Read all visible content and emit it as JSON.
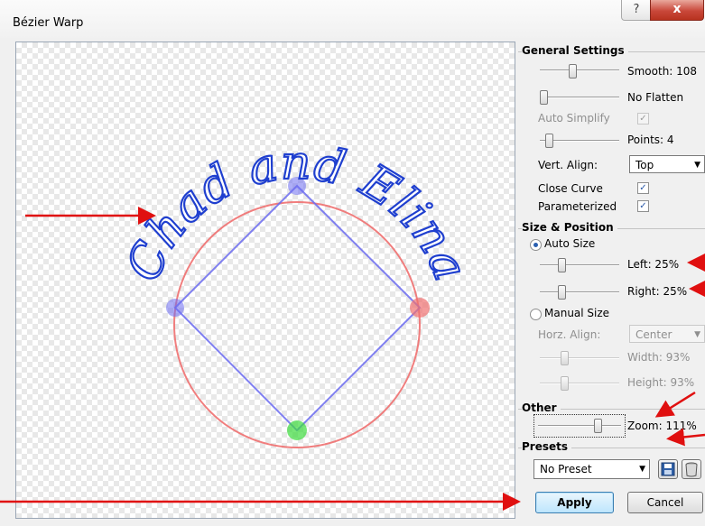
{
  "window": {
    "title": "Bézier Warp",
    "help_label": "?",
    "close_label": "x"
  },
  "canvas": {
    "text": "Chad and Elina",
    "colors": {
      "circle": "#f07070",
      "square": "#6b6bf0",
      "text_outline": "#1f3fcf",
      "green_handle": "#3ddc3d"
    }
  },
  "general": {
    "heading": "General Settings",
    "smooth_label": "Smooth: 108",
    "flatten_label": "No Flatten",
    "auto_simplify_label": "Auto Simplify",
    "auto_simplify_checked": "✓",
    "points_label": "Points: 4",
    "vert_align_label": "Vert. Align:",
    "vert_align_value": "Top",
    "close_curve_label": "Close Curve",
    "close_curve_checked": "✓",
    "parameterized_label": "Parameterized",
    "parameterized_checked": "✓",
    "smooth_level": 0.4,
    "points_level": 0.08
  },
  "size": {
    "heading": "Size & Position",
    "auto_size_label": "Auto Size",
    "left_label": "Left: 25%",
    "right_label": "Right: 25%",
    "manual_size_label": "Manual Size",
    "horz_align_label": "Horz. Align:",
    "horz_align_value": "Center",
    "width_label": "Width: 93%",
    "height_label": "Height: 93%",
    "left_level": 0.25,
    "right_level": 0.25
  },
  "other": {
    "heading": "Other",
    "zoom_label": "Zoom: 111%",
    "zoom_level": 0.75
  },
  "presets": {
    "heading": "Presets",
    "selected": "No Preset"
  },
  "buttons": {
    "apply": "Apply",
    "cancel": "Cancel"
  },
  "annotations": {
    "arrow_color": "#e01010"
  }
}
